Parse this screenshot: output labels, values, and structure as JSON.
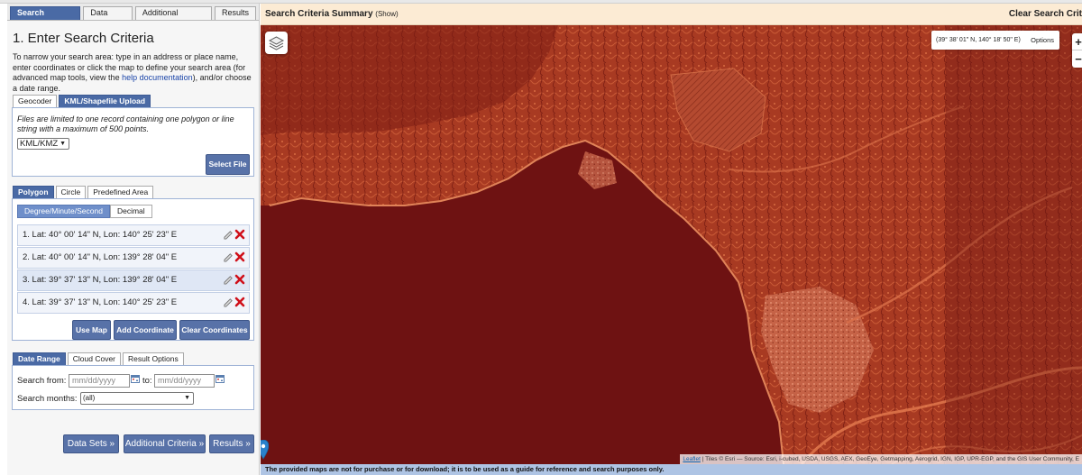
{
  "tabs": [
    "Search Criteria",
    "Data Sets",
    "Additional Criteria",
    "Results"
  ],
  "panel": {
    "heading": "1. Enter Search Criteria",
    "intro_before_link": "To narrow your search area: type in an address or place name, enter coordinates or click the map to define your search area (for advanced map tools, view the ",
    "intro_link": "help documentation",
    "intro_after_link": "), and/or choose a date range."
  },
  "geocoder": {
    "tabs": [
      "Geocoder",
      "KML/Shapefile Upload"
    ],
    "note": "Files are limited to one record containing one polygon or line string with a maximum of 500 points.",
    "file_type": "KML/KMZ",
    "select_file": "Select File"
  },
  "area": {
    "tabs": [
      "Polygon",
      "Circle",
      "Predefined Area"
    ],
    "format_toggle": [
      "Degree/Minute/Second",
      "Decimal"
    ],
    "coordinates": [
      "1.  Lat: 40° 00' 14\" N, Lon: 140° 25' 23\" E",
      "2.  Lat: 40° 00' 14\" N, Lon: 139° 28' 04\" E",
      "3.  Lat: 39° 37' 13\" N, Lon: 139° 28' 04\" E",
      "4.  Lat: 39° 37' 13\" N, Lon: 140° 25' 23\" E"
    ],
    "buttons": [
      "Use Map",
      "Add Coordinate",
      "Clear Coordinates"
    ]
  },
  "date": {
    "tabs": [
      "Date Range",
      "Cloud Cover",
      "Result Options"
    ],
    "search_from_label": "Search from:",
    "from_placeholder": "mm/dd/yyyy",
    "to_label": "to:",
    "to_placeholder": "mm/dd/yyyy",
    "months_label": "Search months:",
    "months_value": "(all)"
  },
  "nav": [
    "Data Sets »",
    "Additional Criteria »",
    "Results »"
  ],
  "summary": {
    "title": "Search Criteria Summary",
    "show": "(Show)",
    "clear": "Clear Search Crit"
  },
  "map": {
    "cursor_coords": "(39° 38' 01\" N, 140° 18' 50\" E)",
    "options": "Options",
    "zoom_in": "+",
    "zoom_out": "−",
    "attribution_link": "Leaflet",
    "attribution_text": " | Tiles © Esri — Source: Esri, i-cubed, USDA, USGS, AEX, GeoEye, Getmapping, Aerogrid, IGN, IGP, UPR-EGP, and the GIS User Community, E",
    "disclaimer": "The provided maps are not for purchase or for download; it is to be used as a guide for reference and search purposes only.",
    "colors": {
      "land": "#b8492c",
      "sea": "#6b1010",
      "overlay": "#7a0e0e"
    }
  },
  "colors": {
    "accent": "#4a6aa5",
    "button": "#5872a8",
    "summary_bg": "#fcebd4",
    "disclaimer_bg": "#aec4e4"
  }
}
